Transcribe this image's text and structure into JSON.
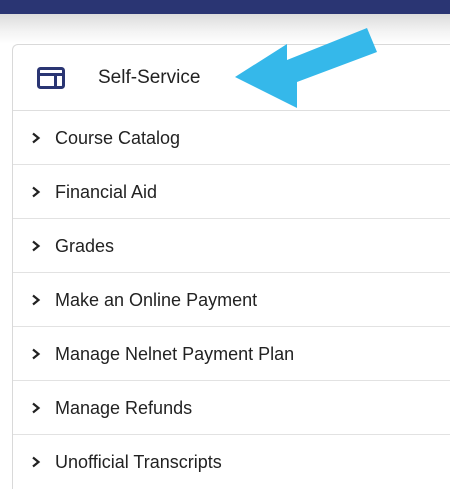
{
  "colors": {
    "top_bar": "#2a3573",
    "icon": "#2a3573",
    "arrow": "#35b8ea",
    "text": "#222222",
    "divider": "#e2e2e2"
  },
  "header": {
    "icon": "card-layout-icon",
    "title": "Self-Service"
  },
  "menu": {
    "items": [
      {
        "label": "Course Catalog",
        "icon": "chevron-right-icon"
      },
      {
        "label": "Financial Aid",
        "icon": "chevron-right-icon"
      },
      {
        "label": "Grades",
        "icon": "chevron-right-icon"
      },
      {
        "label": "Make an Online Payment",
        "icon": "chevron-right-icon"
      },
      {
        "label": "Manage Nelnet Payment Plan",
        "icon": "chevron-right-icon"
      },
      {
        "label": "Manage Refunds",
        "icon": "chevron-right-icon"
      },
      {
        "label": "Unofficial Transcripts",
        "icon": "chevron-right-icon"
      }
    ]
  },
  "annotation": {
    "icon": "pointer-arrow-icon"
  }
}
